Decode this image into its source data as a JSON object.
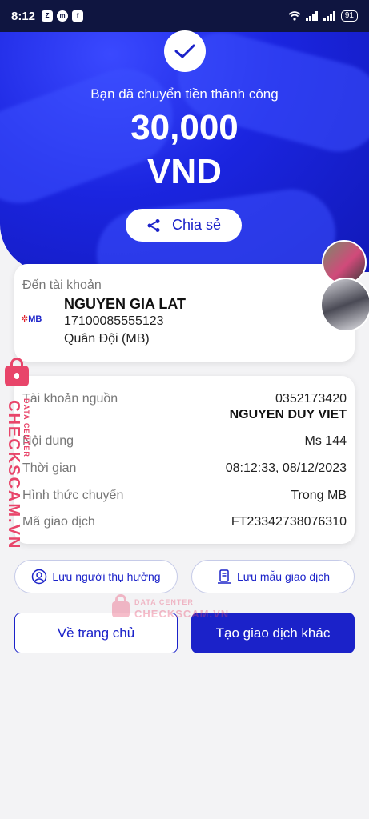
{
  "status_bar": {
    "time": "8:12",
    "battery": "91",
    "app_icons": [
      "zalo-icon",
      "messenger-icon",
      "facebook-icon"
    ]
  },
  "hero": {
    "message": "Bạn đã chuyển tiền thành công",
    "amount": "30,000",
    "currency": "VND",
    "share_label": "Chia sẻ"
  },
  "destination": {
    "label": "Đến tài khoản",
    "bank_logo": "MB",
    "name": "NGUYEN GIA LAT",
    "account": "17100085555123",
    "bank": "Quân Đội (MB)"
  },
  "details": {
    "source_label": "Tài khoản nguồn",
    "source_account": "0352173420",
    "source_name": "NGUYEN DUY VIET",
    "content_label": "Nội dung",
    "content_value": "Ms 144",
    "time_label": "Thời gian",
    "time_value": "08:12:33, 08/12/2023",
    "method_label": "Hình thức chuyển",
    "method_value": "Trong MB",
    "code_label": "Mã giao dịch",
    "code_value": "FT23342738076310"
  },
  "actions": {
    "save_beneficiary": "Lưu người thụ hưởng",
    "save_template": "Lưu mẫu giao dịch",
    "home": "Về trang chủ",
    "new_transaction": "Tạo giao dịch khác"
  },
  "watermark": {
    "brand": "CHECKSCAM.VN",
    "tag": "DATA CENTER"
  },
  "colors": {
    "primary": "#1b22c9",
    "hero": "#1b25e0",
    "watermark": "#e8456a"
  }
}
